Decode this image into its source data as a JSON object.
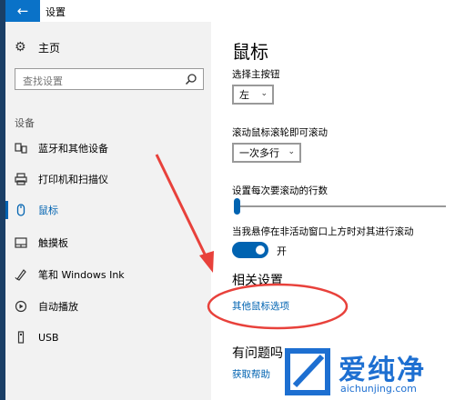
{
  "window": {
    "title": "设置",
    "back_glyph": "←"
  },
  "sidebar": {
    "home_label": "主页",
    "search_placeholder": "查找设置",
    "section_label": "设备",
    "items": [
      {
        "label": "蓝牙和其他设备",
        "icon": "devices-icon"
      },
      {
        "label": "打印机和扫描仪",
        "icon": "printer-icon"
      },
      {
        "label": "鼠标",
        "icon": "mouse-icon",
        "selected": true
      },
      {
        "label": "触摸板",
        "icon": "touchpad-icon"
      },
      {
        "label": "笔和 Windows Ink",
        "icon": "pen-icon"
      },
      {
        "label": "自动播放",
        "icon": "autoplay-icon"
      },
      {
        "label": "USB",
        "icon": "usb-icon"
      }
    ]
  },
  "main": {
    "title": "鼠标",
    "primary_button_label": "选择主按钮",
    "primary_button_value": "左",
    "scroll_label": "滚动鼠标滚轮即可滚动",
    "scroll_value": "一次多行",
    "lines_label": "设置每次要滚动的行数",
    "lines_value_fraction": 0.0,
    "inactive_scroll_label": "当我悬停在非活动窗口上方时对其进行滚动",
    "inactive_scroll_state": "开",
    "related_heading": "相关设置",
    "related_link": "其他鼠标选项",
    "question_heading": "有问题吗",
    "help_link": "获取帮助"
  },
  "watermark": {
    "title": "爱纯净",
    "subtitle": "aichunjing.com"
  },
  "colors": {
    "accent": "#0063b1",
    "annotation": "#e8413b",
    "watermark": "#1d6fd1"
  }
}
